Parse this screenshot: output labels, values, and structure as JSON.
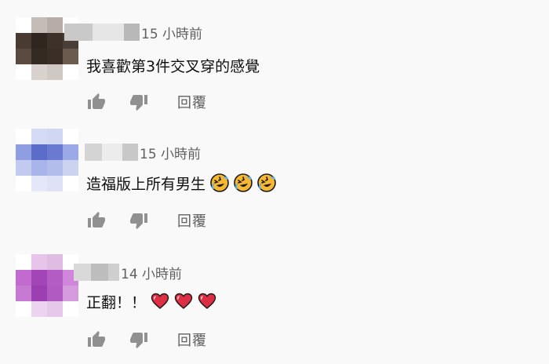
{
  "comments": [
    {
      "timestamp": "15 小時前",
      "text": "我喜歡第3件交叉穿的感覺",
      "emojis": [],
      "reply_label": "回覆",
      "avatar_colors": [
        "#ffffff",
        "#c4bcb7",
        "#b7ada6",
        "#ffffff",
        "#4a3b32",
        "#2f2620",
        "#3e3129",
        "#4a3f38",
        "#5a4a40",
        "#332a24",
        "#3a2e27",
        "#6b5a4e",
        "#ffffff",
        "#d8d2ce",
        "#cfc8c3",
        "#ffffff"
      ],
      "author_blur_colors": [
        "#c9c9c9",
        "#e6e6e6",
        "#b8b8b8"
      ]
    },
    {
      "timestamp": "15 小時前",
      "text": "造福版上所有男生",
      "emojis": [
        "rolling-laughing-emoji",
        "rolling-laughing-emoji",
        "rolling-laughing-emoji"
      ],
      "reply_label": "回覆",
      "avatar_colors": [
        "#ffffff",
        "#d5dbf5",
        "#d0d7f3",
        "#ffffff",
        "#8f9ee0",
        "#5c6cc9",
        "#6a7ad0",
        "#9ba9e6",
        "#c2cbef",
        "#a9b5ea",
        "#b3bdec",
        "#ccd3f1",
        "#ffffff",
        "#e3e7f8",
        "#dde2f6",
        "#ffffff"
      ],
      "author_blur_colors": [
        "#d4d4d4",
        "#ececec",
        "#c8c8c8"
      ]
    },
    {
      "timestamp": "14 小時前",
      "text": "正翻！！",
      "emojis": [
        "red-heart-emoji",
        "red-heart-emoji",
        "red-heart-emoji"
      ],
      "reply_label": "回覆",
      "avatar_colors": [
        "#ffffff",
        "#e7c5ea",
        "#dfbde3",
        "#ffffff",
        "#c36ad0",
        "#a245b6",
        "#b35cc4",
        "#cf86db",
        "#c77ad3",
        "#9c3fb0",
        "#b15ac2",
        "#d69bdf",
        "#ffffff",
        "#ecd3ef",
        "#e6c9ea",
        "#ffffff"
      ],
      "author_blur_colors": [
        "#d9d9d9",
        "#bdbdbd",
        "#cfcfcf"
      ]
    }
  ],
  "icons": {
    "like": "thumbs-up-icon",
    "dislike": "thumbs-down-icon"
  },
  "colors": {
    "text_primary": "#0f0f0f",
    "text_secondary": "#606060",
    "icon": "#909090",
    "background": "#f9f9f9",
    "emoji_face": "#f7b733",
    "heart": "#dd2e44"
  }
}
